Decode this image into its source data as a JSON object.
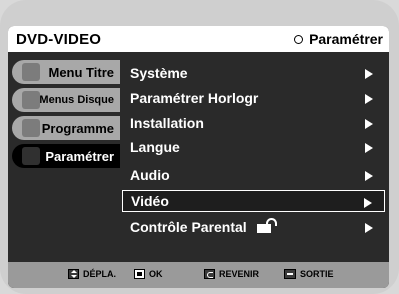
{
  "header": {
    "title": "DVD-VIDEO",
    "right_label": "Paramétrer",
    "right_icon": "circle-icon"
  },
  "sidebar": {
    "items": [
      {
        "label": "Menu Titre",
        "active": false
      },
      {
        "label": "Menus Disque",
        "active": false
      },
      {
        "label": "Programme",
        "active": false
      },
      {
        "label": "Paramétrer",
        "active": true
      }
    ]
  },
  "menu": {
    "items": [
      {
        "label": "Système",
        "selected": false
      },
      {
        "label": "Paramétrer Horlogr",
        "selected": false
      },
      {
        "label": "Installation",
        "selected": false
      },
      {
        "label": "Langue",
        "selected": false
      },
      {
        "label": "Audio",
        "selected": false
      },
      {
        "label": "Vidéo",
        "selected": true
      },
      {
        "label": "Contrôle Parental",
        "selected": false,
        "icon": "lock-icon"
      }
    ]
  },
  "footer": {
    "move": "DÉPLA.",
    "ok": "OK",
    "back": "REVENIR",
    "exit": "SORTIE"
  },
  "colors": {
    "screen_bg": "#2a2a2a",
    "header_bg": "#ffffff",
    "footer_bg": "#9a9a9a",
    "tab_inactive": "#a8a8a8",
    "tab_active": "#000000"
  }
}
